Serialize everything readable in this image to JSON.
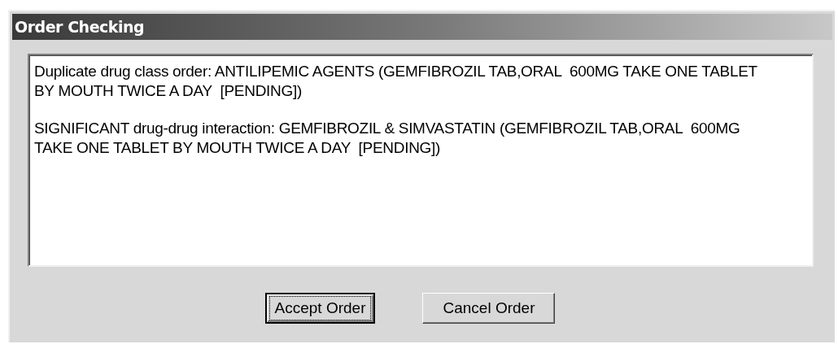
{
  "window": {
    "title": "Order Checking"
  },
  "messages": [
    "Duplicate drug class order: ANTILIPEMIC AGENTS (GEMFIBROZIL TAB,ORAL  600MG TAKE ONE TABLET BY MOUTH TWICE A DAY  [PENDING])",
    "SIGNIFICANT drug-drug interaction: GEMFIBROZIL & SIMVASTATIN (GEMFIBROZIL TAB,ORAL  600MG TAKE ONE TABLET BY MOUTH TWICE A DAY  [PENDING])"
  ],
  "buttons": [
    {
      "label": "Accept Order",
      "default": true
    },
    {
      "label": "Cancel Order",
      "default": false
    }
  ]
}
